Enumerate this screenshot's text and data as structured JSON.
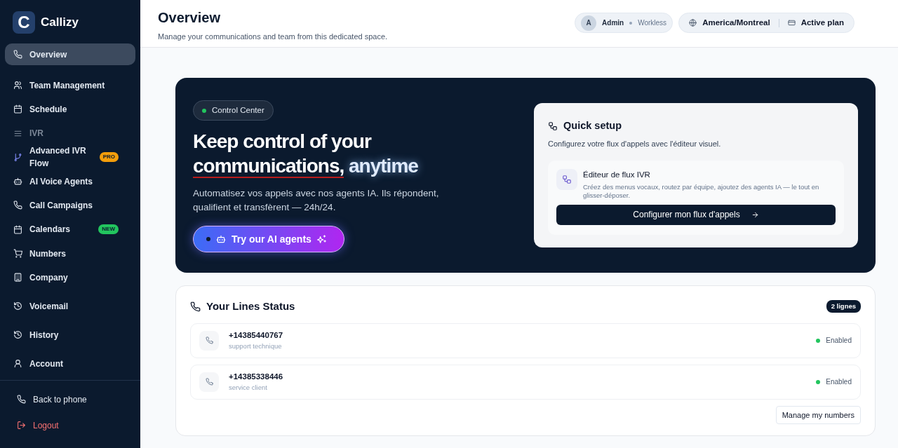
{
  "brand": {
    "logo_letter": "C",
    "name": "Callizy"
  },
  "sidebar": {
    "items": [
      {
        "label": "Overview",
        "kind": "link",
        "selected": true
      },
      {
        "label": "Team Management",
        "kind": "link",
        "selected": false
      },
      {
        "label": "Schedule",
        "kind": "link",
        "selected": false
      },
      {
        "label": "IVR",
        "kind": "section",
        "selected": false
      },
      {
        "label": "Advanced IVR Flow",
        "kind": "link",
        "selected": false,
        "badge": "PRO",
        "color": "#f59e0b"
      },
      {
        "label": "AI Voice Agents",
        "kind": "link",
        "selected": false
      },
      {
        "label": "Call Campaigns",
        "kind": "link",
        "selected": false
      },
      {
        "label": "Calendars",
        "kind": "link",
        "selected": false,
        "badge": "NEW",
        "color": "#22c55e"
      },
      {
        "label": "Numbers",
        "kind": "link",
        "selected": false
      },
      {
        "label": "Company",
        "kind": "link",
        "selected": false
      },
      {
        "label": "Voicemail",
        "kind": "link",
        "selected": false
      },
      {
        "label": "History",
        "kind": "link",
        "selected": false
      },
      {
        "label": "Account",
        "kind": "link",
        "selected": false
      }
    ],
    "footer": [
      {
        "label": "Back to phone",
        "kind": "link"
      },
      {
        "label": "Logout",
        "kind": "danger"
      }
    ]
  },
  "header": {
    "title": "Overview",
    "subtitle": "Manage your communications and team from this dedicated space.",
    "user": {
      "avatar": "A",
      "role": "Admin",
      "org": "Workless"
    },
    "timezone": "America/Montreal",
    "plan": "Active plan"
  },
  "hero": {
    "tag": "Control Center",
    "headline": "Keep control of your",
    "headline_underlined": "communications,",
    "headline_glow": "anytime",
    "text": "Automatisez vos appels avec nos agents IA. Ils répondent, qualifient et transfèrent — 24h/24.",
    "cta": "Try our AI agents"
  },
  "quick_setup": {
    "title": "Quick setup",
    "subtitle": "Configurez votre flux d'appels avec l'éditeur visuel.",
    "editor_title": "Éditeur de flux IVR",
    "editor_text": "Créez des menus vocaux, routez par équipe, ajoutez des agents IA — le tout en glisser-déposer.",
    "button": "Configurer mon flux d'appels"
  },
  "lines": {
    "title": "Your Lines Status",
    "count": "2 lignes",
    "rows": [
      {
        "number": "+14385440767",
        "label": "support technique",
        "status": "Enabled",
        "on": true
      },
      {
        "number": "+14385338446",
        "label": "service client",
        "status": "Enabled",
        "on": true
      }
    ],
    "button": "Manage my numbers"
  }
}
